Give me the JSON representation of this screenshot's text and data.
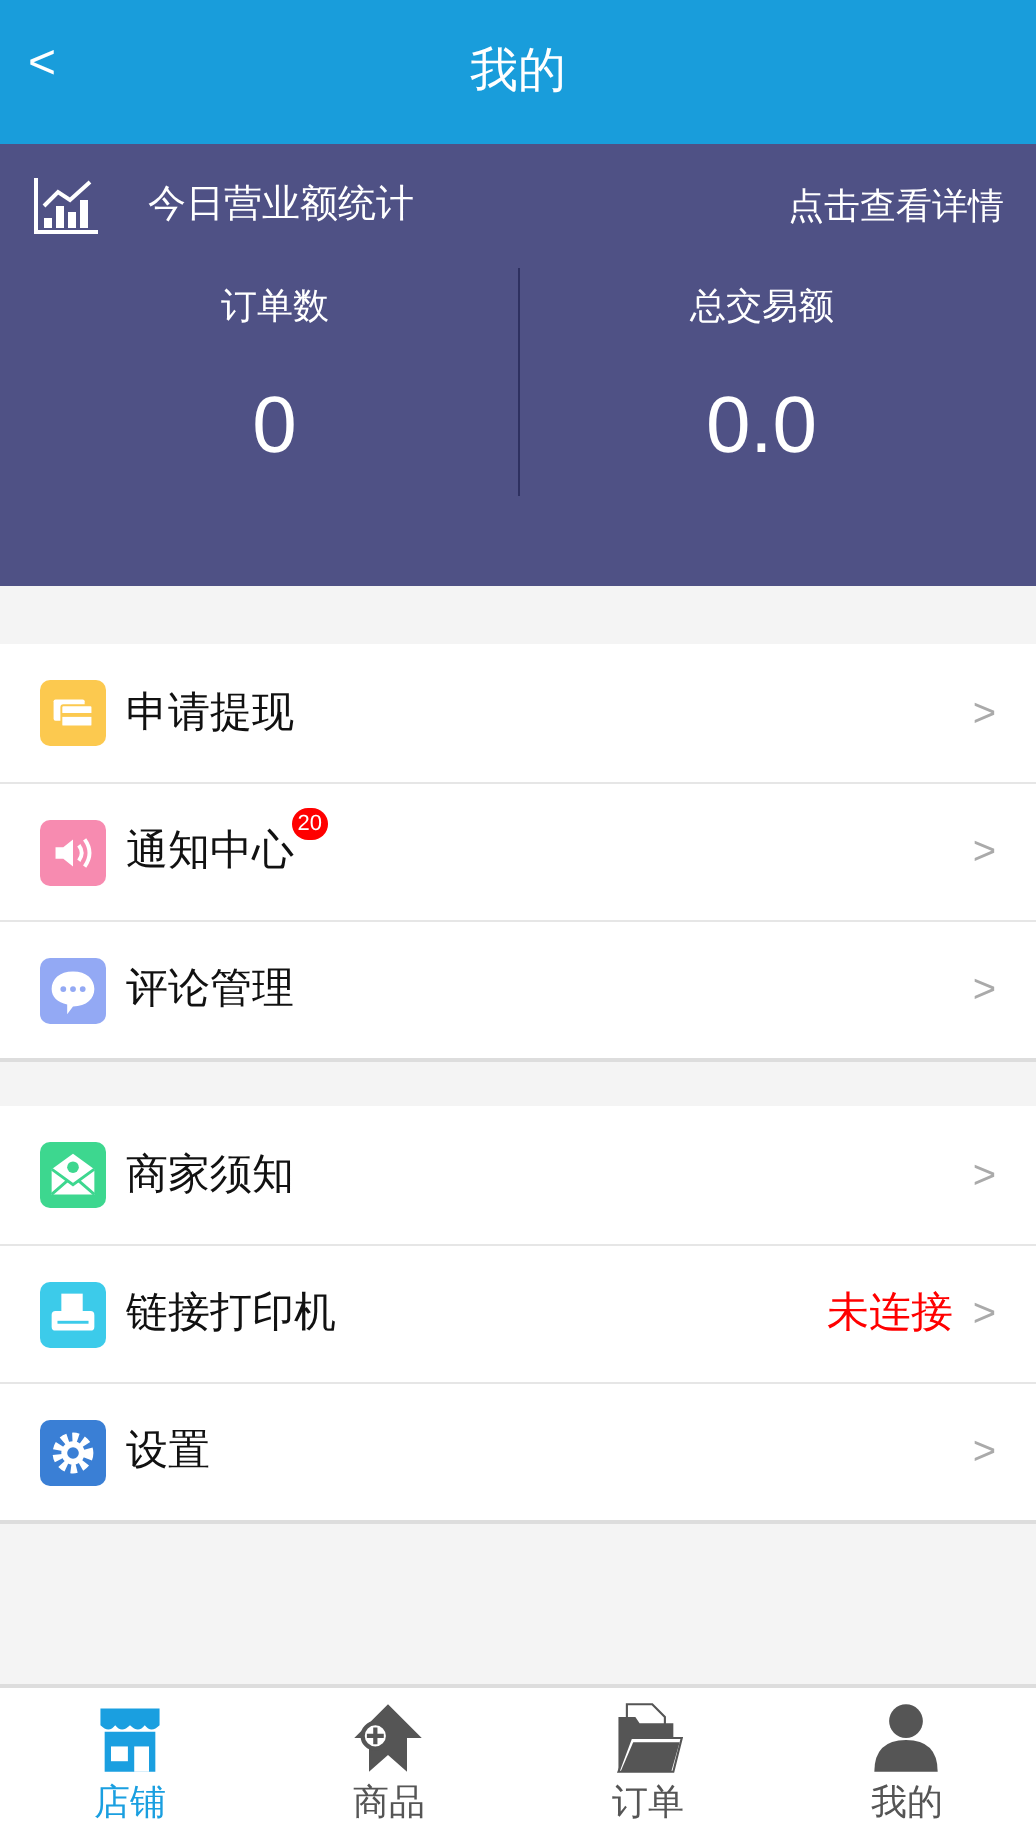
{
  "header": {
    "back": "<",
    "title": "我的"
  },
  "stats": {
    "title": "今日营业额统计",
    "link": "点击查看详情",
    "items": [
      {
        "label": "订单数",
        "value": "0"
      },
      {
        "label": "总交易额",
        "value": "0.0"
      }
    ]
  },
  "menu_groups": [
    {
      "items": [
        {
          "kind": "card",
          "color": "#fcc94f",
          "label": "申请提现",
          "arrow": ">"
        },
        {
          "kind": "speaker",
          "color": "#f78bb0",
          "label": "通知中心",
          "badge": "20",
          "arrow": ">"
        },
        {
          "kind": "chat",
          "color": "#93a9f4",
          "label": "评论管理",
          "arrow": ">"
        }
      ]
    },
    {
      "items": [
        {
          "kind": "mail",
          "color": "#3dd78f",
          "label": "商家须知",
          "arrow": ">"
        },
        {
          "kind": "printer",
          "color": "#3ccbea",
          "label": "链接打印机",
          "status": "未连接",
          "arrow": ">"
        },
        {
          "kind": "gear",
          "color": "#3a7fd5",
          "label": "设置",
          "arrow": ">"
        }
      ]
    }
  ],
  "tabbar": [
    {
      "kind": "shop",
      "label": "店铺",
      "selected": true
    },
    {
      "kind": "tag",
      "label": "商品",
      "selected": false
    },
    {
      "kind": "folder",
      "label": "订单",
      "selected": false
    },
    {
      "kind": "person",
      "label": "我的",
      "selected": false
    }
  ]
}
